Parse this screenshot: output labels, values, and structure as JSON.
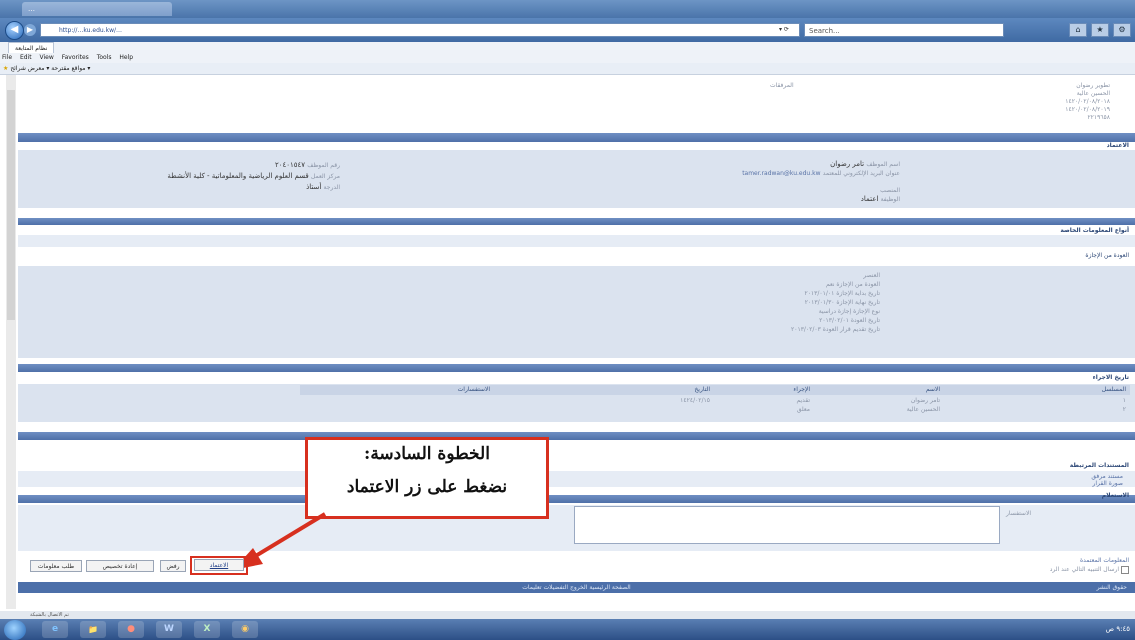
{
  "browser": {
    "tab_label": "…",
    "url": "http://…ku.edu.kw/…",
    "search_label": "Search...",
    "page_tab": "نظام المتابعة",
    "menu": [
      "File",
      "Edit",
      "View",
      "Favorites",
      "Tools",
      "Help"
    ],
    "fav_bar_text": "مواقع مقترحة ▾   معرض شرائح ▾"
  },
  "sections": {
    "approvals": "الاعتماد",
    "info_types": "أنواع المعلومات الخاصة",
    "return_from_leave": "العودة من الإجازة",
    "procedure_history": "تاريخ الاجراء",
    "related_docs": "المستندات المرتبطة",
    "inquiry": "الاستعلام"
  },
  "top_info": {
    "line1": "تطوير رضوان",
    "line2": "الحسين عالية",
    "date1": "١٤٢٠/٠٢/٠٨/٢٠١٨",
    "date2": "١٤٢٠/٠٢/٠٨/٢٠١٩",
    "num": "٢٢١٩٦٥٨",
    "right_label": "المرفقات"
  },
  "approvals": {
    "employee_name_label": "اسم الموظف",
    "employee_name": "تامر رضوان",
    "email_label": "عنوان البريد الإلكتروني للمعتمد",
    "email": "tamer.radwan@ku.edu.kw",
    "position_label": "المنصب",
    "status_label": "الوظيفة",
    "status_value": "اعتماد",
    "job_no_label": "رقم الموظف",
    "job_no": "٢٠٤٠١٥٤٧",
    "center_label": "مركز العمل",
    "center": "قسم العلوم الرياضية والمعلوماتية - كلية الأنشطة",
    "grade_label": "الدرجة",
    "grade": "أستاذ"
  },
  "return_block": {
    "title": "العنصر",
    "rows": [
      "العودة من الإجازة نعم",
      "تاريخ بداية الإجازة ٢٠١٣/٠١/٠١",
      "تاريخ نهاية الإجازة ٢٠١٣/٠١/٣٠",
      "نوع الإجازة إجازة دراسية",
      "تاريخ العودة ٢٠١٣/٠٢/٠١",
      "تاريخ تقديم قرار العودة ٢٠١٣/٠٢/٠٣"
    ]
  },
  "history": {
    "headers": [
      "المسلسل",
      "الاسم",
      "الإجراء",
      "التاريخ",
      "الاستفسارات"
    ],
    "rows": [
      [
        "١",
        "تامر رضوان",
        "تقديم",
        "١٤٢٤/٠٢/١٥"
      ],
      [
        "٢",
        "الحسين عالية",
        "معلق",
        ""
      ]
    ]
  },
  "related_docs": {
    "item1": "مستند مرفق",
    "item2": "صورة القرار"
  },
  "inquiry": {
    "label": "الاستفسار"
  },
  "callout": {
    "line1": "الخطوة السادسة:",
    "line2": "نضغط على زر الاعتماد"
  },
  "buttons": {
    "approve": "الاعتماد",
    "reject": "رفض",
    "reassign": "إعادة تخصيص",
    "request_info": "طلب معلومات"
  },
  "bottom_links": {
    "link1": "المعلومات المعتمدة",
    "link2": "ارسال التنبيه التالي عند الرد"
  },
  "footer": {
    "text": "الصفحة الرئيسية   الخروج   التفضيلات   تعليمات",
    "left": "حقوق النشر",
    "status": "تم الاتصال بالشبكة"
  },
  "taskbar": {
    "apps": [
      "e",
      "📁",
      "●",
      "W",
      "X",
      "◉"
    ],
    "clock": "٩:٤٥ ص"
  },
  "colors": {
    "section_bar": "#5a7cb6",
    "band": "#dbe3ef",
    "callout_border": "#d7301f"
  }
}
